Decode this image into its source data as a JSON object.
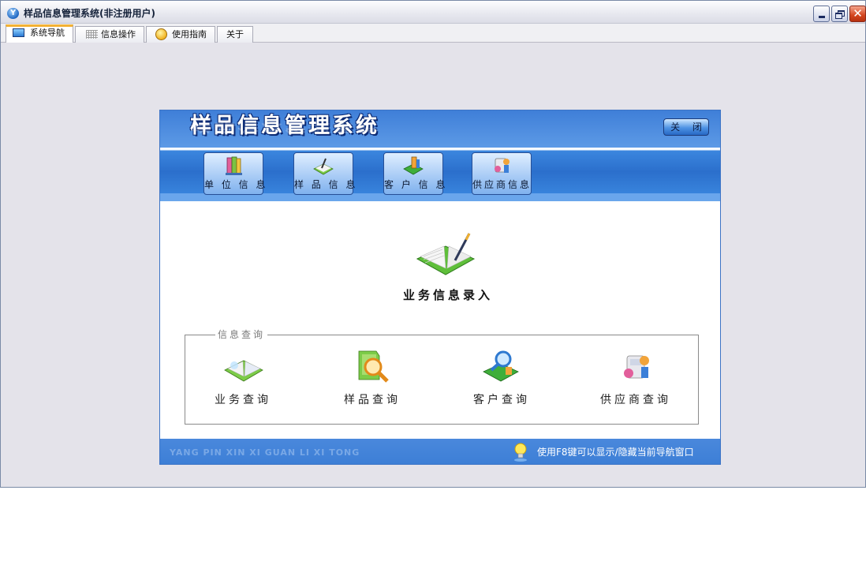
{
  "window": {
    "title": "样品信息管理系统(非注册用户)"
  },
  "tabs": [
    {
      "label": "系统导航",
      "icon": "monitor-icon",
      "active": true
    },
    {
      "label": "信息操作",
      "icon": "grid-icon",
      "active": false
    },
    {
      "label": "使用指南",
      "icon": "help-icon",
      "active": false
    },
    {
      "label": "关于",
      "icon": "",
      "active": false
    }
  ],
  "panel": {
    "brand": "样品信息管理系统",
    "close_label": "关 闭",
    "nav": [
      {
        "label": "单 位 信 息",
        "icon": "books-icon"
      },
      {
        "label": "样 品 信 息",
        "icon": "book-pen-icon"
      },
      {
        "label": "客 户 信 息",
        "icon": "customer-icon"
      },
      {
        "label": "供应商信息",
        "icon": "supplier-icon"
      }
    ],
    "main_action": {
      "label": "业务信息录入",
      "icon": "open-book-pen-icon"
    },
    "query_group": {
      "legend": "信息查询",
      "items": [
        {
          "label": "业务查询",
          "icon": "open-book-icon"
        },
        {
          "label": "样品查询",
          "icon": "magnifier-folder-icon"
        },
        {
          "label": "客户查询",
          "icon": "magnifier-customer-icon"
        },
        {
          "label": "供应商查询",
          "icon": "supplier-icon"
        }
      ]
    },
    "footer": {
      "pinyin": "YANG PIN XIN XI GUAN LI XI TONG",
      "hint": "使用F8键可以显示/隐藏当前导航窗口",
      "hint_icon": "light-bulb-icon"
    }
  },
  "colors": {
    "panel_blue": "#3f7fd8",
    "footer_blue": "#4a88dc",
    "tab_active_accent": "#f3b133"
  }
}
